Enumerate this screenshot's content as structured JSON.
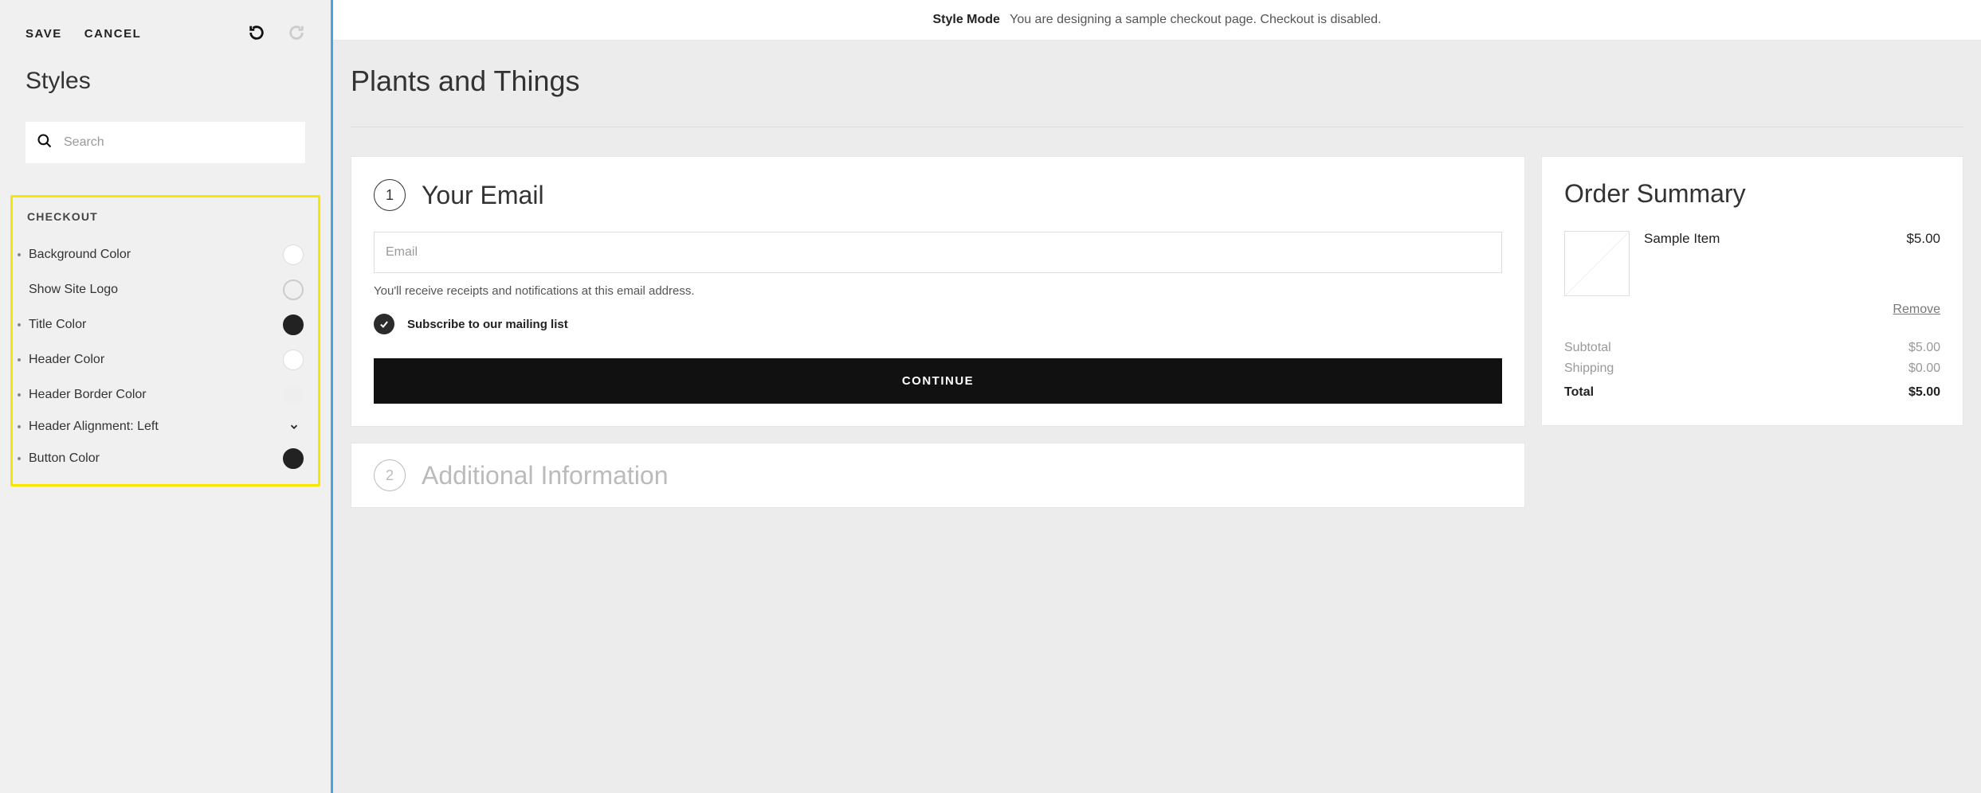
{
  "toolbar": {
    "save": "SAVE",
    "cancel": "CANCEL"
  },
  "sidebar": {
    "title": "Styles",
    "search_placeholder": "Search",
    "section_label": "CHECKOUT",
    "rows": {
      "background_color": "Background Color",
      "show_site_logo": "Show Site Logo",
      "title_color": "Title Color",
      "header_color": "Header Color",
      "header_border_color": "Header Border Color",
      "header_alignment": "Header Alignment: Left",
      "button_color": "Button Color"
    }
  },
  "notice": {
    "strong": "Style Mode",
    "text": "You are designing a sample checkout page. Checkout is disabled."
  },
  "site": {
    "title": "Plants and Things"
  },
  "step1": {
    "num": "1",
    "title": "Your Email",
    "email_placeholder": "Email",
    "hint": "You'll receive receipts and notifications at this email address.",
    "subscribe": "Subscribe to our mailing list",
    "continue": "CONTINUE"
  },
  "step2": {
    "num": "2",
    "title": "Additional Information"
  },
  "summary": {
    "title": "Order Summary",
    "item_name": "Sample Item",
    "item_price": "$5.00",
    "remove": "Remove",
    "subtotal_label": "Subtotal",
    "subtotal_value": "$5.00",
    "shipping_label": "Shipping",
    "shipping_value": "$0.00",
    "total_label": "Total",
    "total_value": "$5.00"
  }
}
